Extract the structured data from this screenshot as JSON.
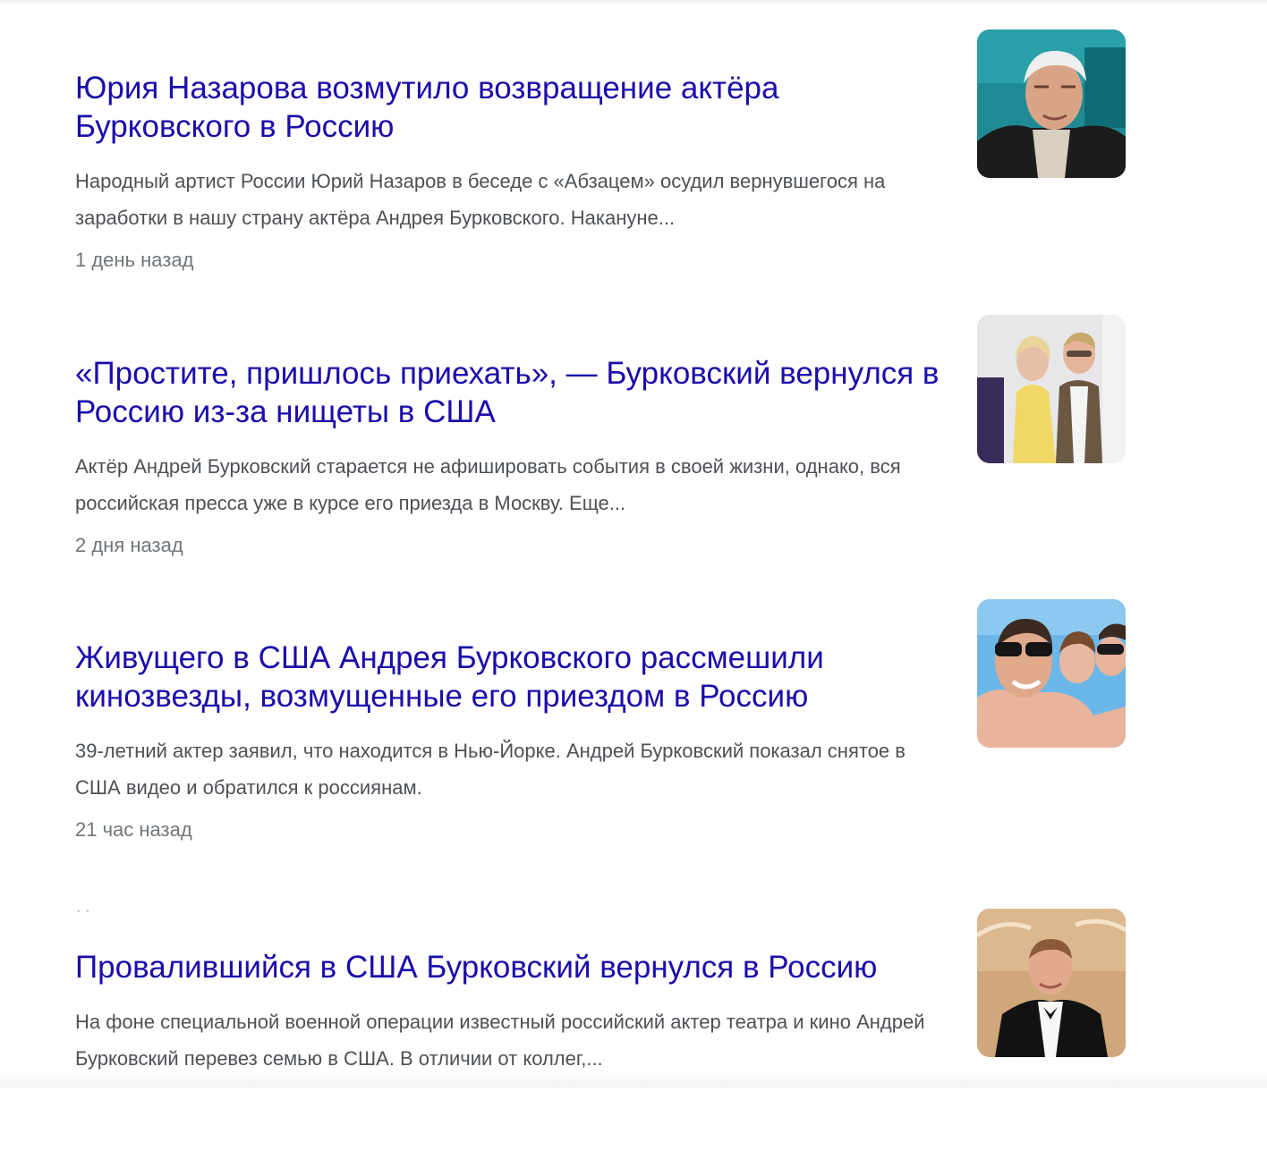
{
  "articles": [
    {
      "title": "Юрия Назарова возмутило возвращение актёра Бурковского в Россию",
      "snippet": "Народный артист России Юрий Назаров в беседе с «Абзацем» осудил вернувшегося на заработки в нашу страну актёра Андрея Бурковского. Накануне...",
      "time": "1 день назад",
      "thumbnail": "old-man-portrait-photo"
    },
    {
      "title": "«Простите, пришлось приехать», — Бурковский вернулся в Россию из-за нищеты в США",
      "snippet": "Актёр Андрей Бурковский старается не афишировать события в своей жизни, однако, вся российская пресса уже в курсе его приезда в Москву. Еще...",
      "time": "2 дня назад",
      "thumbnail": "couple-red-carpet-photo"
    },
    {
      "title": "Живущего в США Андрея Бурковского рассмешили кинозвезды, возмущенные его приездом в Россию",
      "snippet": "39-летний актер заявил, что находится в Нью-Йорке. Андрей Бурковский показал снятое в США видео и обратился к россиянам.",
      "time": "21 час назад",
      "thumbnail": "family-selfie-photo"
    },
    {
      "title": "Провалившийся в США Бурковский вернулся в Россию",
      "snippet": "На фоне специальной военной операции известный российский актер театра и кино Андрей Бурковский перевез семью в США. В отличии от коллег,...",
      "time": "",
      "thumbnail": "man-in-tuxedo-photo"
    }
  ]
}
